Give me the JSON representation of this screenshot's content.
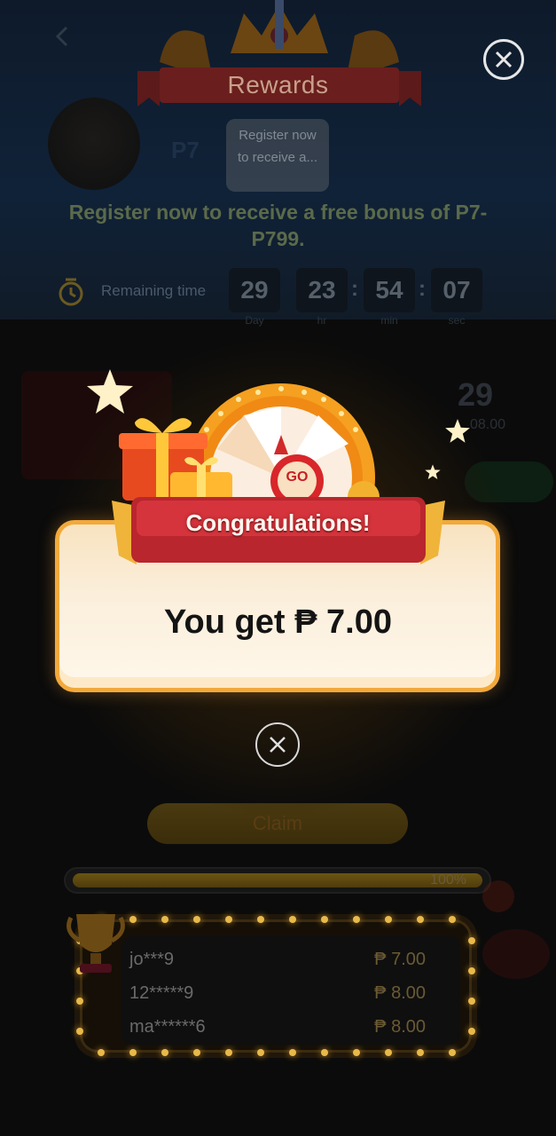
{
  "header": {
    "title": "Rewards",
    "back_icon": "back-arrow-icon",
    "close_icon": "close-icon"
  },
  "promo": {
    "tooltip": "Register now to receive a...",
    "background_amount": "P7",
    "headline": "Register now to receive a free bonus of P7-P799."
  },
  "timer": {
    "label": "Remaining time",
    "days": "29",
    "hours": "23",
    "minutes": "54",
    "seconds": "07",
    "day_unit": "Day",
    "hour_unit": "hr",
    "min_unit": "min",
    "sec_unit": "sec"
  },
  "background_stats": {
    "big_value": "29",
    "value_2": "08.00"
  },
  "claim": {
    "label": "Claim"
  },
  "progress": {
    "percent_text": "100%",
    "fraction": 1.0
  },
  "winners": [
    {
      "name": "jo***9",
      "amount": "₱ 7.00"
    },
    {
      "name": "12*****9",
      "amount": "₱ 8.00"
    },
    {
      "name": "ma******6",
      "amount": "₱ 8.00"
    }
  ],
  "modal": {
    "banner": "Congratulations!",
    "message": "You get ₱ 7.00",
    "wheel_button": "GO",
    "close_icon": "close-circle-icon"
  },
  "colors": {
    "accent_gold": "#f2a93b",
    "ribbon_red": "#c7323a",
    "modal_cream": "#fbefdc"
  }
}
